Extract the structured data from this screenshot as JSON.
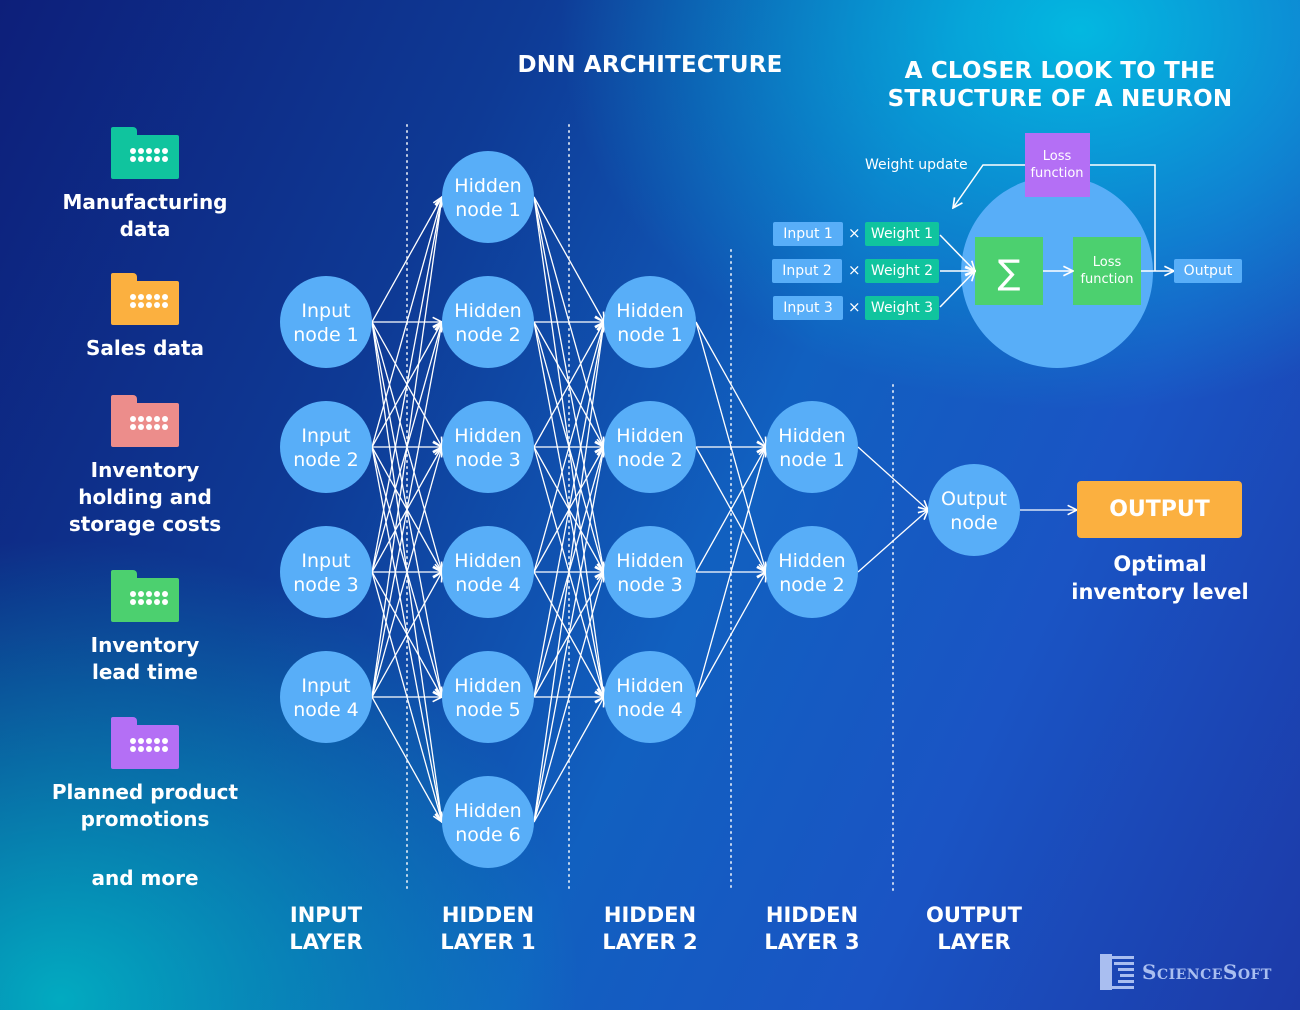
{
  "titles": {
    "main": "DNN ARCHITECTURE",
    "neuron_line1": "A CLOSER LOOK TO THE",
    "neuron_line2": "STRUCTURE OF A NEURON"
  },
  "data_sources": [
    {
      "label": "Manufacturing data",
      "icon": "folder-icon",
      "color": "#10c49e"
    },
    {
      "label": "Sales data",
      "icon": "folder-icon",
      "color": "#fbb040"
    },
    {
      "label": "Inventory holding and storage costs",
      "icon": "folder-icon",
      "color": "#ec8d8b"
    },
    {
      "label": "Inventory lead time",
      "icon": "folder-icon",
      "color": "#4cd06f"
    },
    {
      "label": "Planned product promotions",
      "icon": "folder-icon",
      "color": "#b46ff5"
    }
  ],
  "and_more": "and more",
  "network": {
    "node_color": "#58aef8",
    "layers": [
      {
        "label_line1": "INPUT",
        "label_line2": "LAYER",
        "nodes": [
          [
            "Input",
            "node 1"
          ],
          [
            "Input",
            "node 2"
          ],
          [
            "Input",
            "node 3"
          ],
          [
            "Input",
            "node 4"
          ]
        ]
      },
      {
        "label_line1": "HIDDEN",
        "label_line2": "LAYER 1",
        "nodes": [
          [
            "Hidden",
            "node 1"
          ],
          [
            "Hidden",
            "node 2"
          ],
          [
            "Hidden",
            "node 3"
          ],
          [
            "Hidden",
            "node 4"
          ],
          [
            "Hidden",
            "node 5"
          ],
          [
            "Hidden",
            "node 6"
          ]
        ]
      },
      {
        "label_line1": "HIDDEN",
        "label_line2": "LAYER 2",
        "nodes": [
          [
            "Hidden",
            "node 1"
          ],
          [
            "Hidden",
            "node 2"
          ],
          [
            "Hidden",
            "node 3"
          ],
          [
            "Hidden",
            "node 4"
          ]
        ]
      },
      {
        "label_line1": "HIDDEN",
        "label_line2": "LAYER 3",
        "nodes": [
          [
            "Hidden",
            "node 1"
          ],
          [
            "Hidden",
            "node 2"
          ]
        ]
      },
      {
        "label_line1": "OUTPUT",
        "label_line2": "LAYER",
        "nodes": [
          [
            "Output",
            "node"
          ]
        ]
      }
    ]
  },
  "output": {
    "box_label": "OUTPUT",
    "result_line1": "Optimal",
    "result_line2": "inventory level",
    "color": "#fbb040"
  },
  "neuron": {
    "weight_update": "Weight update",
    "loss_top_line1": "Loss",
    "loss_top_line2": "function",
    "loss_top_color": "#b46ff5",
    "inputs": [
      "Input 1",
      "Input 2",
      "Input 3"
    ],
    "weights": [
      "Weight 1",
      "Weight 2",
      "Weight 3"
    ],
    "times_symbol": "×",
    "sum_symbol": "∑",
    "inner_loss_line1": "Loss",
    "inner_loss_line2": "function",
    "output_label": "Output",
    "green": "#4cd06f"
  },
  "logo": {
    "text": "ScienceSoft"
  }
}
